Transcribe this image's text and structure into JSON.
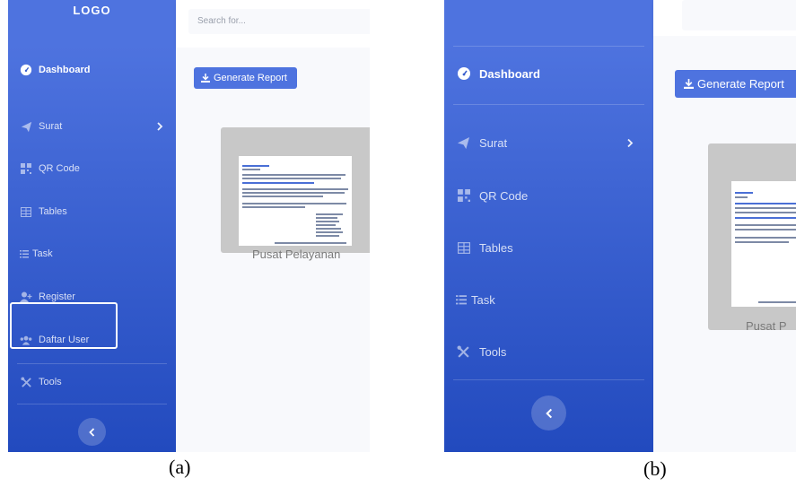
{
  "panel_a": {
    "logo": "LOGO",
    "search": {
      "placeholder": "Search for..."
    },
    "sidebar": {
      "items": [
        {
          "label": "Dashboard",
          "icon": "tachometer-icon",
          "active": true
        },
        {
          "label": "Surat",
          "icon": "paper-plane-icon",
          "has_submenu": true
        },
        {
          "label": "QR Code",
          "icon": "qrcode-icon"
        },
        {
          "label": "Tables",
          "icon": "table-icon"
        },
        {
          "label": "Task",
          "icon": "list-icon"
        },
        {
          "label": "Register",
          "icon": "user-plus-icon"
        },
        {
          "label": "Daftar User",
          "icon": "users-icon"
        },
        {
          "label": "Tools",
          "icon": "tools-icon"
        }
      ],
      "toggle_icon": "chevron-left-icon"
    },
    "main": {
      "generate_button": "Generate Report",
      "card_label": "Pusat Pelayanan"
    }
  },
  "panel_b": {
    "sidebar": {
      "items": [
        {
          "label": "Dashboard",
          "icon": "tachometer-icon",
          "active": true
        },
        {
          "label": "Surat",
          "icon": "paper-plane-icon",
          "has_submenu": true
        },
        {
          "label": "QR Code",
          "icon": "qrcode-icon"
        },
        {
          "label": "Tables",
          "icon": "table-icon"
        },
        {
          "label": "Task",
          "icon": "list-icon"
        },
        {
          "label": "Tools",
          "icon": "tools-icon"
        }
      ],
      "toggle_icon": "chevron-left-icon"
    },
    "main": {
      "generate_button": "Generate Report",
      "card_label": "Pusat P"
    }
  },
  "captions": {
    "a": "(a)",
    "b": "(b)"
  },
  "colors": {
    "sidebar_top": "#4e73df",
    "sidebar_bottom": "#224abe",
    "button": "#4e73df",
    "card": "#c8c8c8"
  }
}
